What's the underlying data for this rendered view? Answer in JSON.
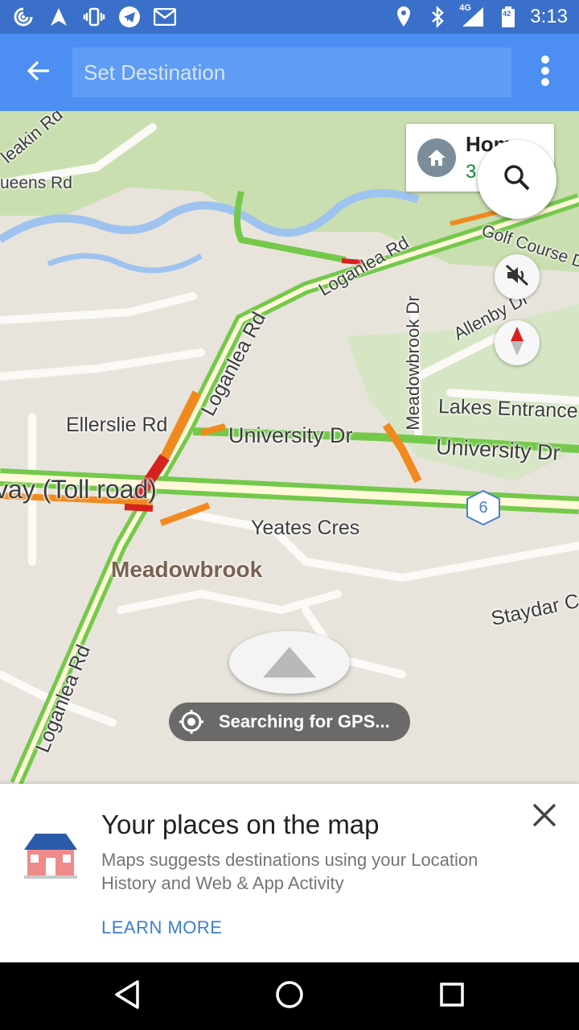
{
  "status_bar": {
    "left_icons": [
      "hotspot-icon",
      "navigation-icon",
      "vibrate-icon",
      "telegram-icon",
      "gmail-icon"
    ],
    "right_icons": [
      "location-icon",
      "bluetooth-icon",
      "signal-4g-icon",
      "battery-icon"
    ],
    "network": "4G",
    "battery_level": "42",
    "time": "3:13"
  },
  "toolbar": {
    "back_icon": "arrow-back-icon",
    "destination_placeholder": "Set Destination",
    "overflow_icon": "more-vert-icon"
  },
  "map": {
    "road_labels": {
      "leakin": "leakin Rd",
      "queens": "ueens Rd",
      "loganlea_upper": "Loganlea Rd",
      "loganlea_mid": "Loganlea Rd",
      "loganlea_lower": "Loganlea Rd",
      "golf_course": "Golf Course Dr",
      "allenby": "Allenby Dr",
      "meadowbrook_dr": "Meadowbrook Dr",
      "lakes_entrance": "Lakes Entrance",
      "ellerslie": "Ellerslie Rd",
      "university_left": "University Dr",
      "university_right": "University Dr",
      "tollway": "vay (Toll road)",
      "yeates": "Yeates Cres",
      "staydar": "Staydar C"
    },
    "place_label": "Meadowbrook",
    "highway_shield": "6",
    "home_chip": {
      "title": "Hom",
      "subtitle": "3",
      "icon": "home-icon"
    },
    "search_icon": "search-icon",
    "mute_icon": "volume-off-icon",
    "compass_icon": "compass-icon",
    "gps_status": "Searching for GPS...",
    "gps_icon": "gps-searching-icon",
    "traffic_colors": {
      "free": "#74c94b",
      "slow": "#f08a1e",
      "jam": "#d6221f"
    }
  },
  "promo_sheet": {
    "icon": "house-illustration-icon",
    "title": "Your places on the map",
    "body": "Maps suggests destinations using your Location History and Web & App Activity",
    "action": "LEARN MORE",
    "close_icon": "close-icon"
  },
  "nav_bar": {
    "back": "nav-back-icon",
    "home": "nav-home-icon",
    "recents": "nav-recents-icon"
  }
}
